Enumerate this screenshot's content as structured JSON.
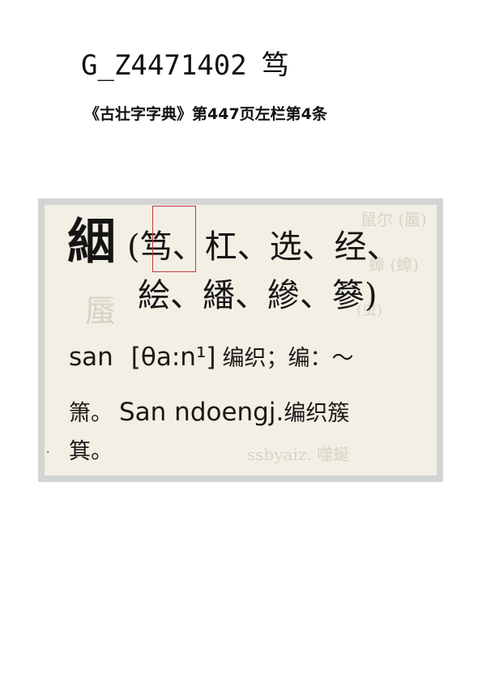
{
  "header": {
    "code": "G_Z4471402",
    "character": "笃",
    "source": "《古壮字字典》第447页左栏第4条"
  },
  "scan": {
    "headword": "絪",
    "variants_row1": "(笃、杠、选、经、",
    "variants_row2": "絵、繙、縿、篸)",
    "def_line1_word": "san",
    "def_line1_ipa": "[θa:n¹]",
    "def_line1_gloss": "编织；编：～",
    "def_line2_cjk": "箫。",
    "def_line2_latin": "San ndoengj.",
    "def_line2_gloss": "编织簇",
    "def_line3_cjk": "箕。",
    "highlight_color": "#c0393b",
    "paper_color": "#f3efe4"
  }
}
